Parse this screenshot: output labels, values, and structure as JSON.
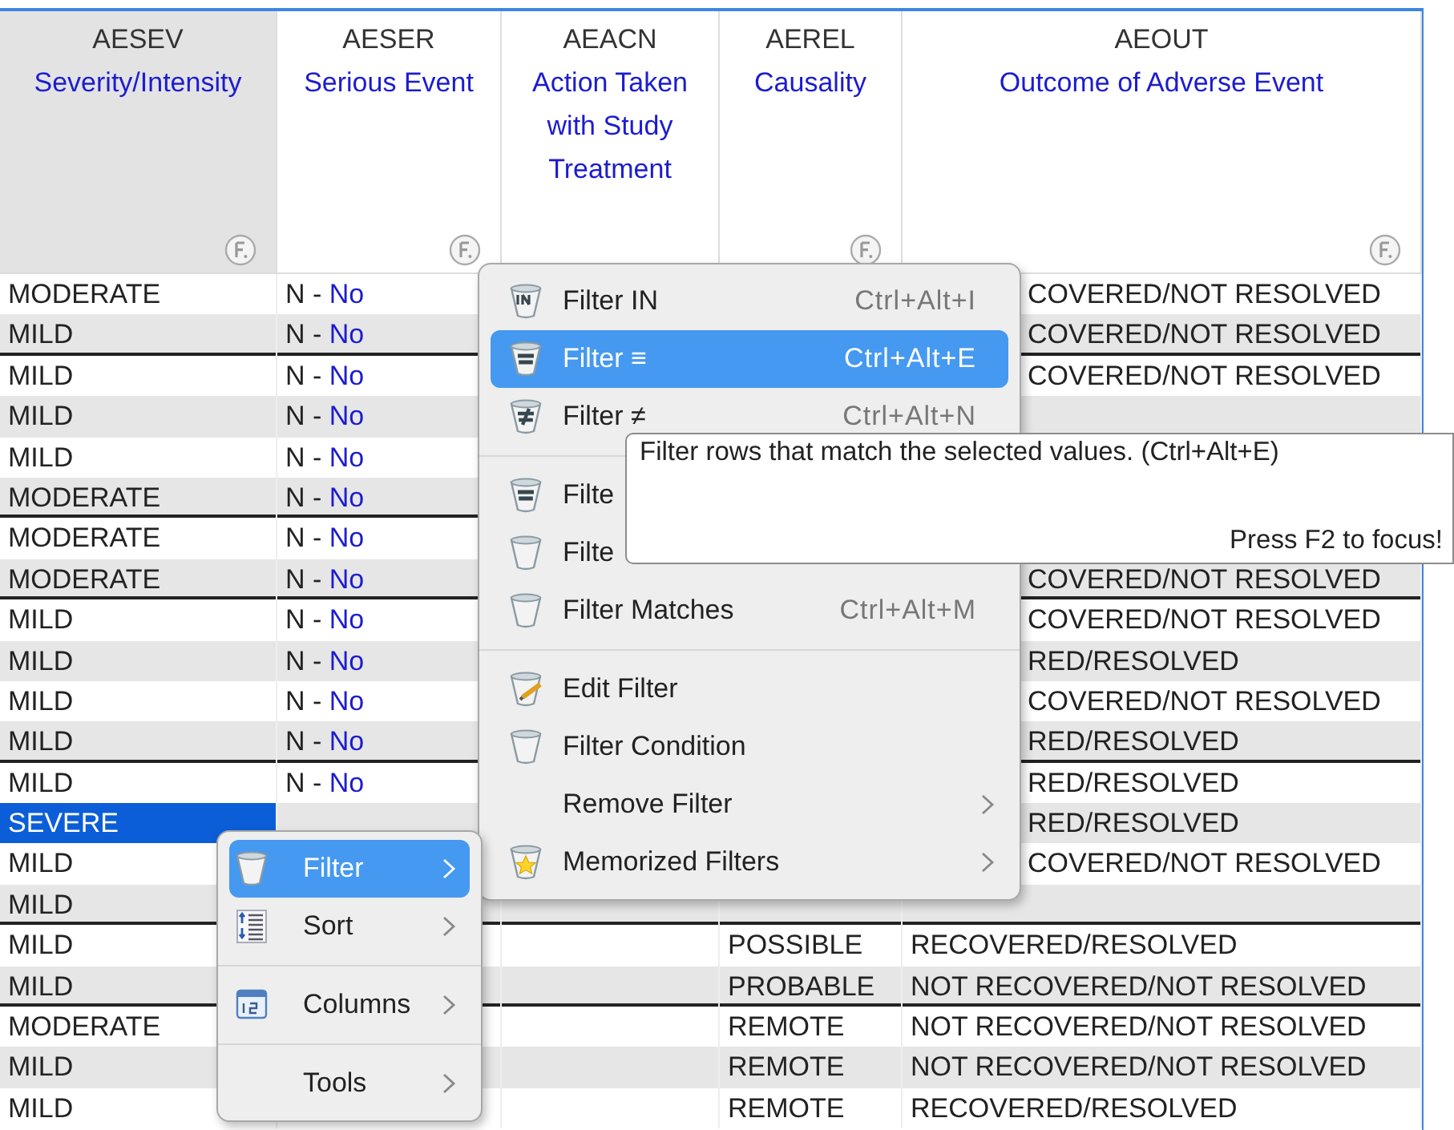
{
  "table": {
    "columns": [
      {
        "code": "AESEV",
        "label": "Severity/Intensity",
        "filter_icon": true,
        "selected": true
      },
      {
        "code": "AESER",
        "label": "Serious Event",
        "filter_icon": true,
        "selected": false
      },
      {
        "code": "AEACN",
        "label": "Action Taken with Study Treatment",
        "filter_icon": false,
        "selected": false
      },
      {
        "code": "AEREL",
        "label": "Causality",
        "filter_icon": true,
        "selected": false
      },
      {
        "code": "AEOUT",
        "label": "Outcome of Adverse Event",
        "filter_icon": true,
        "selected": false
      }
    ],
    "rows": [
      {
        "selected": false,
        "group_end": false,
        "aesev": "MODERATE",
        "aeser": {
          "code": "N -",
          "decode": "No"
        },
        "aeout": "COVERED/NOT RESOLVED"
      },
      {
        "selected": false,
        "group_end": true,
        "aesev": "MILD",
        "aeser": {
          "code": "N -",
          "decode": "No"
        },
        "aeout": "COVERED/NOT RESOLVED"
      },
      {
        "selected": false,
        "group_end": false,
        "aesev": "MILD",
        "aeser": {
          "code": "N -",
          "decode": "No"
        },
        "aeout": "COVERED/NOT RESOLVED"
      },
      {
        "selected": false,
        "group_end": false,
        "aesev": "MILD",
        "aeser": {
          "code": "N -",
          "decode": "No"
        }
      },
      {
        "selected": false,
        "group_end": false,
        "aesev": "MILD",
        "aeser": {
          "code": "N -",
          "decode": "No"
        }
      },
      {
        "selected": false,
        "group_end": true,
        "aesev": "MODERATE",
        "aeser": {
          "code": "N -",
          "decode": "No"
        }
      },
      {
        "selected": false,
        "group_end": false,
        "aesev": "MODERATE",
        "aeser": {
          "code": "N -",
          "decode": "No"
        }
      },
      {
        "selected": false,
        "group_end": true,
        "aesev": "MODERATE",
        "aeser": {
          "code": "N -",
          "decode": "No"
        },
        "aeout": "COVERED/NOT RESOLVED"
      },
      {
        "selected": false,
        "group_end": false,
        "aesev": "MILD",
        "aeser": {
          "code": "N -",
          "decode": "No"
        },
        "aeout": "COVERED/NOT RESOLVED"
      },
      {
        "selected": false,
        "group_end": false,
        "aesev": "MILD",
        "aeser": {
          "code": "N -",
          "decode": "No"
        },
        "aeout": "RED/RESOLVED"
      },
      {
        "selected": false,
        "group_end": false,
        "aesev": "MILD",
        "aeser": {
          "code": "N -",
          "decode": "No"
        },
        "aeout": "COVERED/NOT RESOLVED"
      },
      {
        "selected": false,
        "group_end": true,
        "aesev": "MILD",
        "aeser": {
          "code": "N -",
          "decode": "No"
        },
        "aeout": "RED/RESOLVED"
      },
      {
        "selected": false,
        "group_end": false,
        "aesev": "MILD",
        "aeser": {
          "code": "N -",
          "decode": "No"
        },
        "aeout": "RED/RESOLVED"
      },
      {
        "selected": true,
        "group_end": false,
        "aesev": "SEVERE",
        "aeout": "RED/RESOLVED"
      },
      {
        "selected": false,
        "group_end": false,
        "aesev": "MILD",
        "aeout": "COVERED/NOT RESOLVED"
      },
      {
        "selected": false,
        "group_end": true,
        "aesev": "MILD"
      },
      {
        "selected": false,
        "group_end": false,
        "aesev": "MILD",
        "aerel": "POSSIBLE",
        "aeout": "RECOVERED/RESOLVED"
      },
      {
        "selected": false,
        "group_end": true,
        "aesev": "MILD",
        "aerel": "PROBABLE",
        "aeout": "NOT RECOVERED/NOT RESOLVED"
      },
      {
        "selected": false,
        "group_end": false,
        "aesev": "MODERATE",
        "aerel": "REMOTE",
        "aeout": "NOT RECOVERED/NOT RESOLVED"
      },
      {
        "selected": false,
        "group_end": false,
        "aesev": "MILD",
        "aerel": "REMOTE",
        "aeout": "NOT RECOVERED/NOT RESOLVED"
      },
      {
        "selected": false,
        "group_end": false,
        "aesev": "MILD",
        "aerel": "REMOTE",
        "aeout": "RECOVERED/RESOLVED"
      }
    ]
  },
  "filter_menu": {
    "groups": [
      [
        {
          "label": "Filter IN",
          "shortcut": "Ctrl+Alt+I",
          "selected": false,
          "submenu": false
        },
        {
          "label": "Filter ≡",
          "shortcut": "Ctrl+Alt+E",
          "selected": true,
          "submenu": false
        },
        {
          "label": "Filter ≠",
          "shortcut": "Ctrl+Alt+N",
          "selected": false,
          "submenu": false
        }
      ],
      [
        {
          "label": "Filte",
          "selected": false,
          "submenu": false
        },
        {
          "label": "Filte",
          "selected": false,
          "submenu": false
        },
        {
          "label": "Filter Matches",
          "shortcut": "Ctrl+Alt+M",
          "selected": false,
          "submenu": false
        }
      ],
      [
        {
          "label": "Edit Filter",
          "selected": false,
          "submenu": false
        },
        {
          "label": "Filter Condition",
          "selected": false,
          "submenu": false
        },
        {
          "label": "Remove Filter",
          "selected": false,
          "submenu": true
        },
        {
          "label": "Memorized Filters",
          "selected": false,
          "submenu": true
        }
      ]
    ]
  },
  "context_menu": {
    "groups": [
      [
        {
          "label": "Filter",
          "selected": true,
          "submenu": true
        },
        {
          "label": "Sort",
          "selected": false,
          "submenu": true
        }
      ],
      [
        {
          "label": "Columns",
          "selected": false,
          "submenu": true
        }
      ],
      [
        {
          "label": "Tools",
          "selected": false,
          "submenu": true
        }
      ]
    ]
  },
  "tooltip": {
    "text": "Filter rows that match the selected values. (Ctrl+Alt+E)",
    "hint": "Press F2 to focus!"
  }
}
